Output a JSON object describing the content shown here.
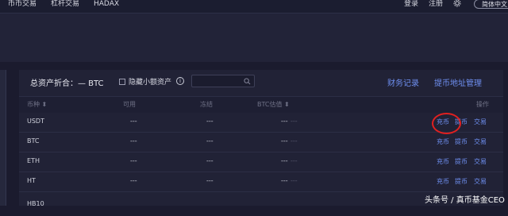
{
  "nav": {
    "items": [
      "币币交易",
      "杠杆交易",
      "HADAX"
    ],
    "login": "登录",
    "register": "注册",
    "language": "简体中文"
  },
  "assets": {
    "summary_label": "总资产折合：",
    "summary_value": "— BTC",
    "hide_small_label": "隐藏小额资产",
    "info_icon_text": "i",
    "search_placeholder": "",
    "finance_record_link": "财务记录",
    "withdraw_address_link": "提币地址管理"
  },
  "table": {
    "headers": {
      "currency": "币种",
      "available": "可用",
      "frozen": "冻结",
      "btc_value": "BTC估值",
      "action": "操作"
    },
    "rows": [
      {
        "currency": "USDT",
        "available": "---",
        "frozen": "---",
        "btc_value": "---",
        "btc_value_extra": "---"
      },
      {
        "currency": "BTC",
        "available": "---",
        "frozen": "---",
        "btc_value": "---",
        "btc_value_extra": "---"
      },
      {
        "currency": "ETH",
        "available": "---",
        "frozen": "---",
        "btc_value": "---",
        "btc_value_extra": "---"
      },
      {
        "currency": "HT",
        "available": "---",
        "frozen": "---",
        "btc_value": "---",
        "btc_value_extra": "---"
      },
      {
        "currency": "HB10",
        "available": "",
        "frozen": "",
        "btc_value": "",
        "btc_value_extra": ""
      }
    ],
    "actions": {
      "deposit": "充币",
      "withdraw": "提币",
      "trade": "交易"
    }
  },
  "watermark": "头条号 / 真币基金CEO",
  "colors": {
    "link": "#6e8ff0",
    "highlight_circle": "#e02020",
    "background": "#1b1b2e"
  }
}
